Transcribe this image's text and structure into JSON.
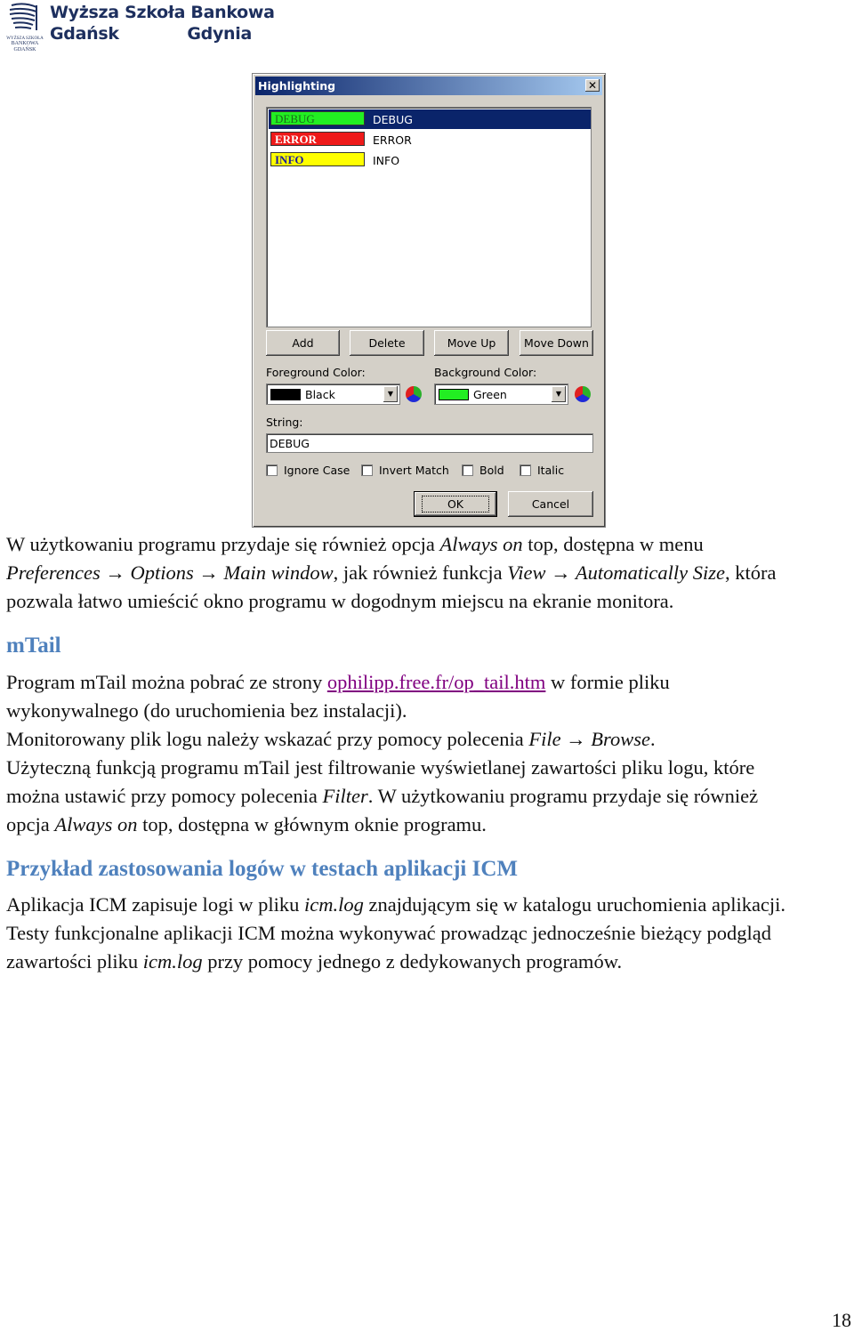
{
  "header": {
    "logo_line1": "Wyższa Szkoła Bankowa",
    "logo_city1": "Gdańsk",
    "logo_city2": "Gdynia",
    "logo_mark_text": "WYŻSZA SZKOŁA BANKOWA GDAŃSK"
  },
  "dialog": {
    "title": "Highlighting",
    "close": "✕",
    "rules": [
      {
        "swatch": "DEBUG",
        "label": "DEBUG",
        "fg": "#1a6a1a",
        "bg": "#22ee22",
        "selected": true
      },
      {
        "swatch": "ERROR",
        "label": "ERROR",
        "fg": "#ffffff",
        "bg": "#ee1a1a",
        "selected": false
      },
      {
        "swatch": "INFO",
        "label": "INFO",
        "fg": "#1a1aa0",
        "bg": "#ffff00",
        "selected": false
      }
    ],
    "buttons": {
      "add": "Add",
      "delete": "Delete",
      "move_up": "Move Up",
      "move_down": "Move Down",
      "ok": "OK",
      "cancel": "Cancel"
    },
    "foreground_label": "Foreground Color:",
    "foreground_value": "Black",
    "foreground_color": "#000000",
    "background_label": "Background Color:",
    "background_value": "Green",
    "background_color": "#22ee22",
    "string_label": "String:",
    "string_value": "DEBUG",
    "checkboxes": [
      {
        "label": "Ignore Case",
        "checked": false
      },
      {
        "label": "Invert Match",
        "checked": false
      },
      {
        "label": "Bold",
        "checked": false
      },
      {
        "label": "Italic",
        "checked": false
      }
    ]
  },
  "content": {
    "para1": [
      [
        {
          "t": "W użytkowaniu programu przydaje się również opcja "
        },
        {
          "t": "Always on",
          "i": true
        },
        {
          "t": " top, dostępna w menu"
        }
      ],
      [
        {
          "t": "Preferences → Options → Main window",
          "i": true
        },
        {
          "t": ", jak również funkcja "
        },
        {
          "t": "View → Automatically Size",
          "i": true
        },
        {
          "t": ", która"
        }
      ],
      [
        {
          "t": "pozwala łatwo umieścić okno programu w dogodnym miejscu na ekranie monitora."
        }
      ]
    ],
    "heading1": "mTail",
    "para2": [
      [
        {
          "t": "Program mTail można pobrać ze strony "
        },
        {
          "t": "ophilipp.free.fr/op_tail.htm",
          "link": true
        },
        {
          "t": " w formie pliku"
        }
      ],
      [
        {
          "t": "wykonywalnego (do uruchomienia bez instalacji)."
        }
      ],
      [
        {
          "t": "Monitorowany plik logu należy wskazać przy pomocy polecenia "
        },
        {
          "t": "File → Browse",
          "i": true
        },
        {
          "t": "."
        }
      ],
      [
        {
          "t": "Użyteczną funkcją programu mTail jest filtrowanie wyświetlanej zawartości pliku logu, które"
        }
      ],
      [
        {
          "t": "można ustawić przy pomocy polecenia "
        },
        {
          "t": "Filter",
          "i": true
        },
        {
          "t": ". W użytkowaniu programu przydaje się również"
        }
      ],
      [
        {
          "t": "opcja "
        },
        {
          "t": "Always on",
          "i": true
        },
        {
          "t": " top, dostępna w głównym oknie programu."
        }
      ]
    ],
    "heading2": "Przykład zastosowania logów w testach aplikacji ICM",
    "para3": [
      [
        {
          "t": "Aplikacja ICM zapisuje logi w pliku "
        },
        {
          "t": "icm.log",
          "i": true
        },
        {
          "t": " znajdującym się w katalogu uruchomienia aplikacji."
        }
      ],
      [
        {
          "t": "Testy funkcjonalne aplikacji ICM można wykonywać prowadząc jednocześnie bieżący podgląd"
        }
      ],
      [
        {
          "t": "zawartości pliku "
        },
        {
          "t": "icm.log",
          "i": true
        },
        {
          "t": " przy pomocy jednego z dedykowanych programów."
        }
      ]
    ],
    "link_color": "#800080",
    "heading_color": "#4f81bd"
  },
  "footer": {
    "page_number": "18"
  }
}
